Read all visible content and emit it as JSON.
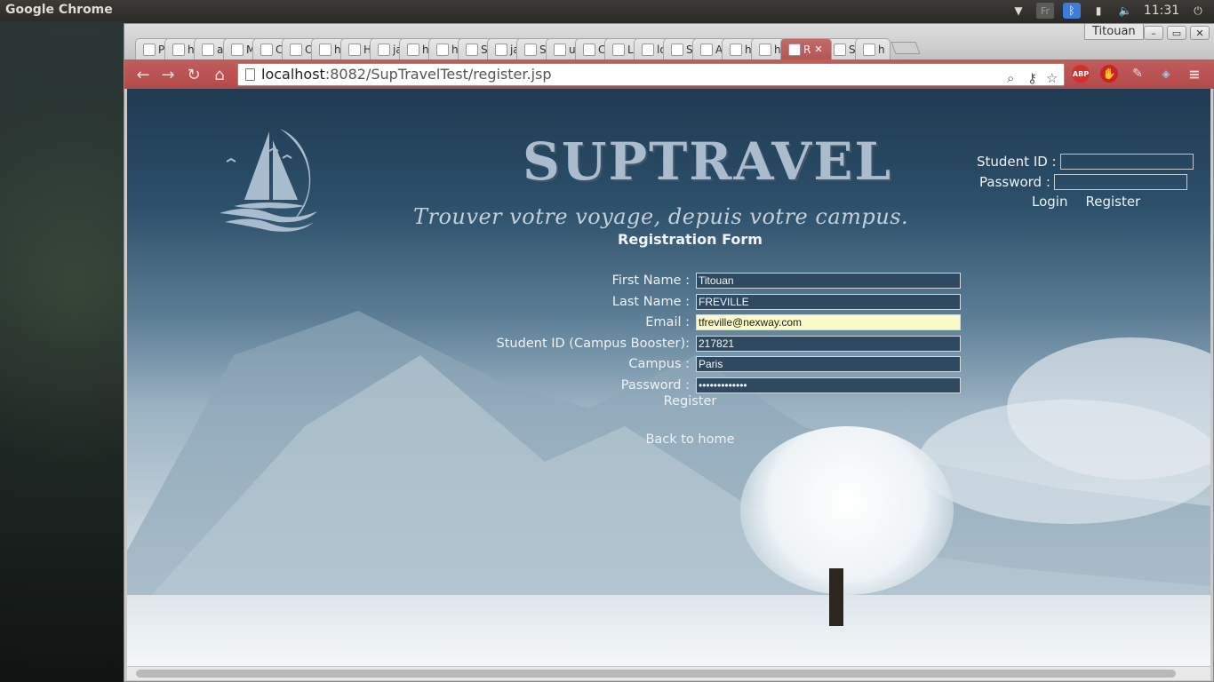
{
  "os": {
    "app_title": "Google Chrome",
    "keyboard": "Fr",
    "clock": "11:31"
  },
  "browser": {
    "profile_name": "Titouan",
    "tabs": [
      {
        "label": "P",
        "icon": "github-icon"
      },
      {
        "label": "h",
        "icon": "page-icon"
      },
      {
        "label": "a",
        "icon": "github-icon"
      },
      {
        "label": "M",
        "icon": "mail-icon"
      },
      {
        "label": "C",
        "icon": "outlook-icon"
      },
      {
        "label": "C",
        "icon": "chrome-web-icon"
      },
      {
        "label": "h",
        "icon": "page-icon"
      },
      {
        "label": "H",
        "icon": "html5-icon"
      },
      {
        "label": "ja",
        "icon": "java-icon"
      },
      {
        "label": "h",
        "icon": "page-icon"
      },
      {
        "label": "h",
        "icon": "page-icon"
      },
      {
        "label": "S",
        "icon": "notion-icon"
      },
      {
        "label": "ja",
        "icon": "java-icon"
      },
      {
        "label": "S",
        "icon": "sql-icon"
      },
      {
        "label": "u",
        "icon": "google-icon"
      },
      {
        "label": "C",
        "icon": "eclipse-icon"
      },
      {
        "label": "L",
        "icon": "orange-icon"
      },
      {
        "label": "lo",
        "icon": "page-icon"
      },
      {
        "label": "S",
        "icon": "page-icon"
      },
      {
        "label": "A",
        "icon": "page-icon"
      },
      {
        "label": "h",
        "icon": "java-icon"
      },
      {
        "label": "h",
        "icon": "java-icon"
      },
      {
        "label": "R",
        "icon": "page-icon",
        "active": true
      },
      {
        "label": "S",
        "icon": "sncf-icon"
      },
      {
        "label": "h",
        "icon": "page-icon"
      }
    ],
    "url_host": "localhost",
    "url_rest": ":8082/SupTravelTest/register.jsp",
    "extensions": [
      "ABP"
    ]
  },
  "header": {
    "brand": "SUPTRAVEL",
    "tagline": "Trouver votre voyage, depuis votre campus."
  },
  "login": {
    "student_id_label": "Student ID :",
    "password_label": "Password :",
    "login_link": "Login",
    "register_link": "Register"
  },
  "form": {
    "title": "Registration Form",
    "fields": [
      {
        "label": "First Name :",
        "value": "Titouan"
      },
      {
        "label": "Last Name :",
        "value": "FREVILLE"
      },
      {
        "label": "Email :",
        "value": "tfreville@nexway.com"
      },
      {
        "label": "Student ID (Campus Booster):",
        "value": "217821"
      },
      {
        "label": "Campus :",
        "value": "Paris"
      },
      {
        "label": "Password :",
        "value": "•••••••••••••"
      }
    ],
    "submit_label": "Register",
    "back_link": "Back to home"
  },
  "colors": {
    "toolbar": "#b24a4a",
    "brand_text": "#aabcce",
    "input_bg": "#2f4a60",
    "focused_input_bg": "#fafac9"
  }
}
